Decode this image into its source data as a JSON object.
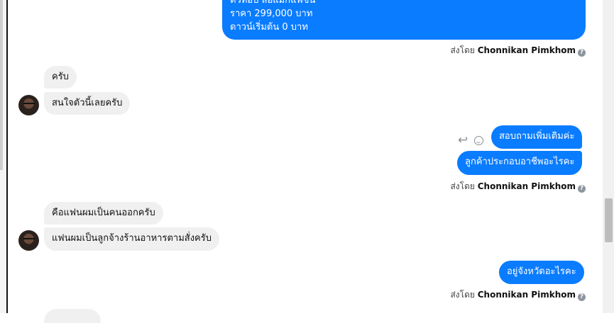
{
  "sent_top": {
    "line1": "ตัวท็อป ล้อแม็กแฟชั่น",
    "line2": "ราคา 299,000 บาท",
    "line3": "ดาวน์เริ่มต้น 0 บาท"
  },
  "sender": {
    "prefix": "ส่งโดย",
    "name": "Chonnikan Pimkhom"
  },
  "incoming_1": [
    "ครับ",
    "สนใจตัวนี้เลยครับ"
  ],
  "outgoing_2": [
    "สอบถามเพิ่มเติมค่ะ",
    "ลูกค้าประกอบอาชีพอะไรคะ"
  ],
  "incoming_2": [
    "คือแฟนผมเป็นคนออกครับ",
    "แฟนผมเป็นลูกจ้างร้านอาหารตามสั่งครับ"
  ],
  "outgoing_3": [
    "อยู่จังหวัดอะไรคะ"
  ],
  "icons": {
    "info": "info-icon",
    "reply": "reply-icon",
    "react": "smiley-icon",
    "avatar": "user-avatar"
  },
  "colors": {
    "outgoing_bubble": "#0a7cff",
    "incoming_bubble": "#f0f0f0"
  }
}
